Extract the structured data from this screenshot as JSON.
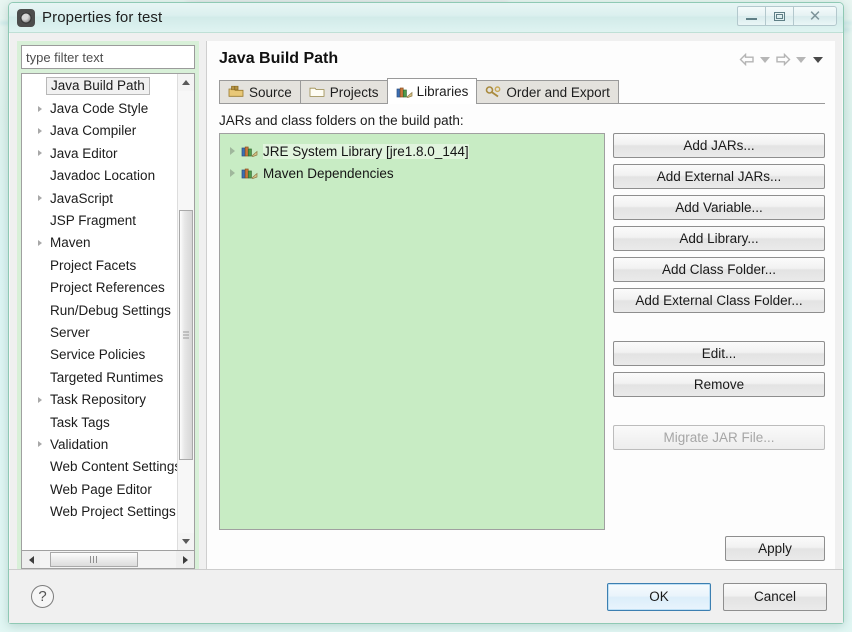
{
  "window": {
    "title": "Properties for test",
    "icon": "eclipse-properties-icon",
    "controls": {
      "minimize": "minimize-button",
      "maximize": "maximize-button",
      "close": "close-button",
      "close_glyph": "✕"
    }
  },
  "filter": {
    "value": "type filter text",
    "placeholder": "type filter text"
  },
  "sidebar": {
    "items": [
      {
        "label": "Java Build Path",
        "expandable": false,
        "selected": true
      },
      {
        "label": "Java Code Style",
        "expandable": true,
        "selected": false
      },
      {
        "label": "Java Compiler",
        "expandable": true,
        "selected": false
      },
      {
        "label": "Java Editor",
        "expandable": true,
        "selected": false
      },
      {
        "label": "Javadoc Location",
        "expandable": false,
        "selected": false
      },
      {
        "label": "JavaScript",
        "expandable": true,
        "selected": false
      },
      {
        "label": "JSP Fragment",
        "expandable": false,
        "selected": false
      },
      {
        "label": "Maven",
        "expandable": true,
        "selected": false
      },
      {
        "label": "Project Facets",
        "expandable": false,
        "selected": false
      },
      {
        "label": "Project References",
        "expandable": false,
        "selected": false
      },
      {
        "label": "Run/Debug Settings",
        "expandable": false,
        "selected": false
      },
      {
        "label": "Server",
        "expandable": false,
        "selected": false
      },
      {
        "label": "Service Policies",
        "expandable": false,
        "selected": false
      },
      {
        "label": "Targeted Runtimes",
        "expandable": false,
        "selected": false
      },
      {
        "label": "Task Repository",
        "expandable": true,
        "selected": false
      },
      {
        "label": "Task Tags",
        "expandable": false,
        "selected": false
      },
      {
        "label": "Validation",
        "expandable": true,
        "selected": false
      },
      {
        "label": "Web Content Settings",
        "expandable": false,
        "selected": false
      },
      {
        "label": "Web Page Editor",
        "expandable": false,
        "selected": false
      },
      {
        "label": "Web Project Settings",
        "expandable": false,
        "selected": false
      }
    ],
    "scroll_up_icon": "scroll-up-arrow-icon",
    "scroll_down_icon": "scroll-down-arrow-icon",
    "scroll_left_icon": "scroll-left-arrow-icon",
    "scroll_right_icon": "scroll-right-arrow-icon"
  },
  "page": {
    "title": "Java Build Path",
    "nav": {
      "back_icon": "back-arrow-icon",
      "back_dropdown_icon": "chevron-down-icon",
      "forward_icon": "forward-arrow-icon",
      "forward_dropdown_icon": "chevron-down-icon",
      "menu_dropdown_icon": "chevron-down-icon"
    },
    "tabs": [
      {
        "label": "Source",
        "icon": "source-folder-icon",
        "active": false
      },
      {
        "label": "Projects",
        "icon": "projects-folder-icon",
        "active": false
      },
      {
        "label": "Libraries",
        "icon": "libraries-books-icon",
        "active": true
      },
      {
        "label": "Order and Export",
        "icon": "order-export-icon",
        "active": false
      }
    ],
    "section_label": "JARs and class folders on the build path:",
    "libraries": [
      {
        "label": "JRE System Library [jre1.8.0_144]",
        "icon": "library-books-icon",
        "selected": true
      },
      {
        "label": "Maven Dependencies",
        "icon": "library-books-icon",
        "selected": false
      }
    ],
    "buttons": [
      {
        "label": "Add JARs...",
        "enabled": true,
        "gap": false
      },
      {
        "label": "Add External JARs...",
        "enabled": true,
        "gap": false
      },
      {
        "label": "Add Variable...",
        "enabled": true,
        "gap": false
      },
      {
        "label": "Add Library...",
        "enabled": true,
        "gap": false
      },
      {
        "label": "Add Class Folder...",
        "enabled": true,
        "gap": false
      },
      {
        "label": "Add External Class Folder...",
        "enabled": true,
        "gap": false
      },
      {
        "label": "Edit...",
        "enabled": true,
        "gap": true
      },
      {
        "label": "Remove",
        "enabled": true,
        "gap": false
      },
      {
        "label": "Migrate JAR File...",
        "enabled": false,
        "gap": true
      }
    ],
    "apply_label": "Apply"
  },
  "footer": {
    "help_icon": "help-question-icon",
    "help_glyph": "?",
    "ok_label": "OK",
    "cancel_label": "Cancel"
  },
  "colors": {
    "list_background": "#c8ecc4",
    "sidebar_background": "#d8f0d8",
    "dialog_chrome": "#f0f0f0",
    "default_button_border": "#3c7fb1"
  }
}
